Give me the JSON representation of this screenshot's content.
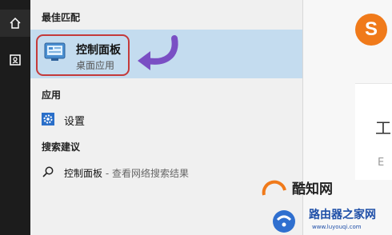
{
  "panel": {
    "best_match_title": "最佳匹配",
    "best_match": {
      "name": "控制面板",
      "subtitle": "桌面应用"
    },
    "apps_title": "应用",
    "apps": [
      {
        "label": "设置"
      }
    ],
    "suggestions_title": "搜索建议",
    "suggestions": [
      {
        "query": "控制面板",
        "extra": " - 查看网络搜索结果"
      }
    ]
  },
  "background": {
    "logo_letter": "S",
    "char1": "工",
    "char2": "E"
  },
  "watermark": {
    "brand": "酷知网",
    "brand2": "路由器之家网",
    "url": "www.luyouqi.com"
  }
}
